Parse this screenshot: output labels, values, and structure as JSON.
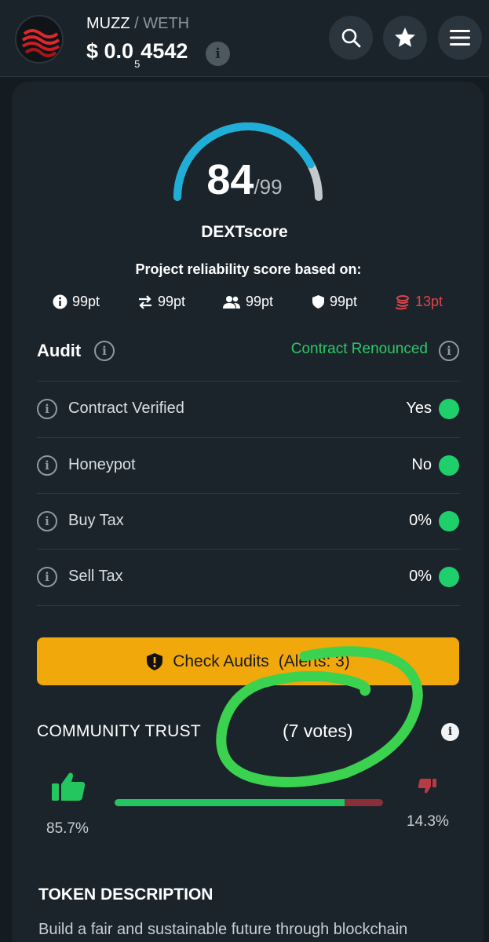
{
  "header": {
    "base_token": "MUZZ",
    "separator": "/",
    "quote_token": "WETH",
    "price_prefix": "$ 0.0",
    "price_subscript": "5",
    "price_digits": "4542",
    "icons": [
      "search-icon",
      "star-icon",
      "menu-icon"
    ]
  },
  "score": {
    "value": "84",
    "max": "/99",
    "fraction": 0.8485,
    "label": "DEXTscore",
    "basis_text": "Project reliability score based on:",
    "points": [
      {
        "icon": "info-icon",
        "label": "99pt"
      },
      {
        "icon": "swap-icon",
        "label": "99pt"
      },
      {
        "icon": "users-icon",
        "label": "99pt"
      },
      {
        "icon": "shield-icon",
        "label": "99pt"
      },
      {
        "icon": "coins-icon",
        "label": "13pt"
      }
    ],
    "colors": {
      "gauge": "#1eaed8",
      "remainder": "#c4c9cd",
      "low_score": "#e0444a"
    }
  },
  "audit": {
    "title": "Audit",
    "status": "Contract Renounced",
    "rows": [
      {
        "label": "Contract Verified",
        "value": "Yes"
      },
      {
        "label": "Honeypot",
        "value": "No"
      },
      {
        "label": "Buy Tax",
        "value": "0%"
      },
      {
        "label": "Sell Tax",
        "value": "0%"
      }
    ],
    "button_label": "Check Audits",
    "button_alerts": "(Alerts: 3)"
  },
  "community": {
    "title": "COMMUNITY TRUST",
    "votes": "(7 votes)",
    "positive_pct": "85.7%",
    "negative_pct": "14.3%",
    "positive_fraction": 0.857,
    "colors": {
      "positive": "#24c65f",
      "negative": "#8a2f37"
    }
  },
  "token_description": {
    "title": "TOKEN DESCRIPTION",
    "text": "Build a fair and sustainable future through blockchain"
  }
}
